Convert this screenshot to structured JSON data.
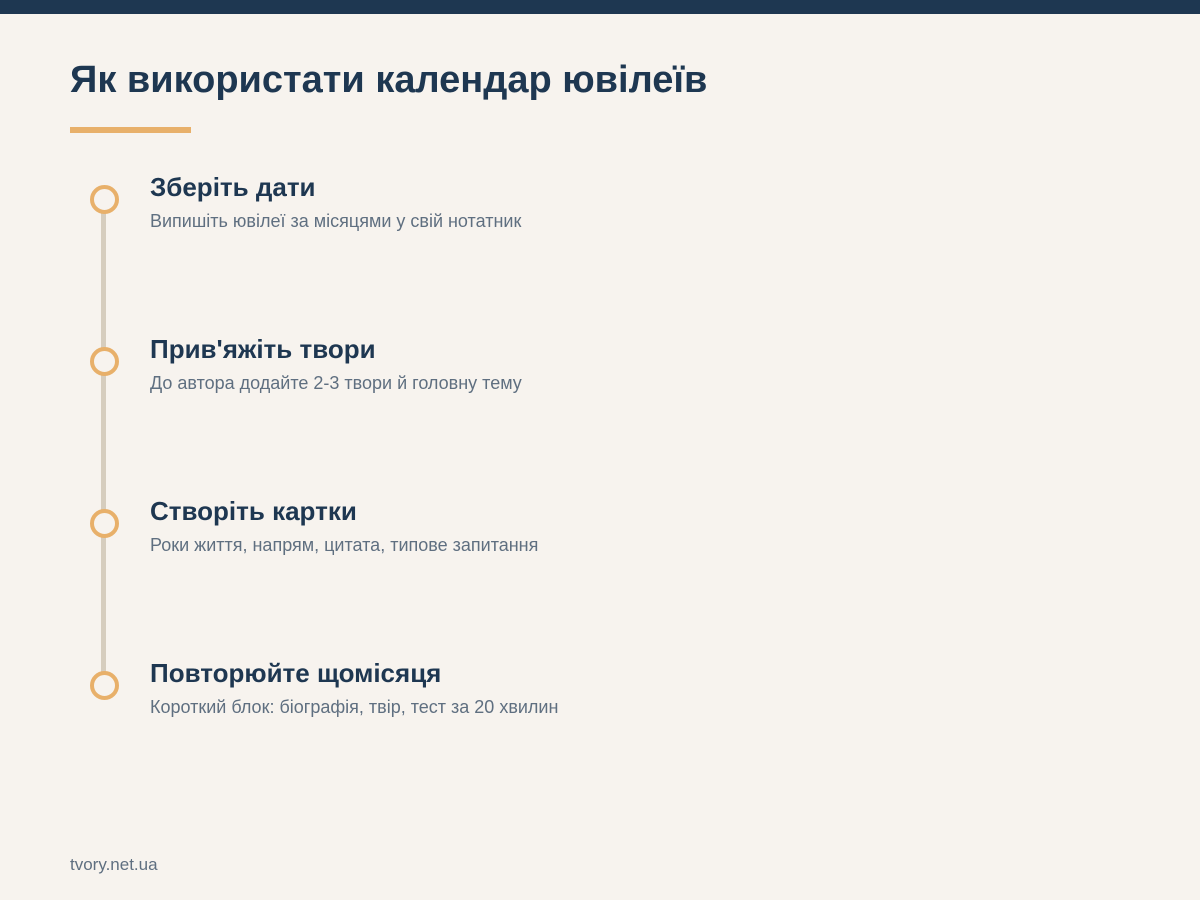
{
  "header": {
    "title": "Як використати календар ювілеїв"
  },
  "steps": [
    {
      "title": "Зберіть дати",
      "description": "Випишіть ювілеї за місяцями у свій нотатник"
    },
    {
      "title": "Прив'яжіть твори",
      "description": "До автора додайте 2-3 твори й головну тему"
    },
    {
      "title": "Створіть картки",
      "description": "Роки життя, напрям, цитата, типове запитання"
    },
    {
      "title": "Повторюйте щомісяця",
      "description": "Короткий блок: біографія, твір, тест за 20 хвилин"
    }
  ],
  "footer": {
    "brand": "tvory.net.ua"
  },
  "colors": {
    "primary": "#1e3751",
    "accent": "#e8b06a",
    "background": "#f7f3ee",
    "muted_text": "#5f6f80",
    "timeline": "#d6cdbe"
  }
}
